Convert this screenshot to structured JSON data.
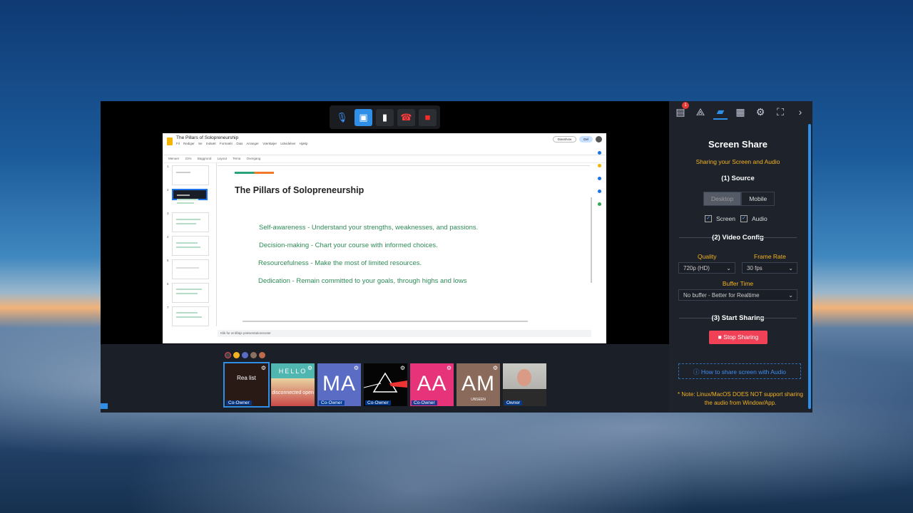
{
  "toolbar": {
    "buttons": [
      "mic-icon",
      "camera-off-icon",
      "signal-icon",
      "hangup-icon",
      "stop-icon"
    ]
  },
  "slides_app": {
    "title": "The Pillars of Solopreneurship",
    "menu": [
      "Fil",
      "Rediger",
      "Se",
      "Indsæt",
      "Formatér",
      "Dias",
      "Arranger",
      "Værktøjer",
      "Udvidelser",
      "Hjælp"
    ],
    "tools": [
      "Menuer",
      "21%",
      "Baggrund",
      "Layout",
      "Tema",
      "Overgang"
    ],
    "slideshow_label": "Diasshow",
    "share_label": "Del",
    "slide_numbers": [
      "1",
      "2",
      "3",
      "4",
      "5",
      "6",
      "7"
    ],
    "notes_placeholder": "Klik for at tilføje præsentationsnoter",
    "slide": {
      "title": "The Pillars of Solopreneurship",
      "bullets": [
        "Self-awareness - Understand your strengths, weaknesses, and passions.",
        "Decision-making - Chart your course with informed choices.",
        "Resourcefulness - Make the most of limited resources.",
        "Dedication - Remain committed to your goals, through highs and lows"
      ]
    }
  },
  "participants": [
    {
      "label": "Rea list",
      "role": "Co-Owner"
    },
    {
      "label": "HELLO",
      "sub": "disconnected open",
      "role": ""
    },
    {
      "label": "MA",
      "role": "Co-Owner"
    },
    {
      "label": "",
      "role": "Co-Owner"
    },
    {
      "label": "AA",
      "role": "Co-Owner"
    },
    {
      "label": "AM",
      "sub": "UNSEEN",
      "role": ""
    },
    {
      "label": "",
      "role": "Owner"
    }
  ],
  "panel": {
    "badge_count": "1",
    "title": "Screen Share",
    "subtitle": "Sharing your Screen and Audio",
    "source_heading": "(1) Source",
    "source_options": [
      "Desktop",
      "Mobile"
    ],
    "screen_label": "Screen",
    "audio_label": "Audio",
    "video_heading": "(2) Video Config",
    "quality_label": "Quality",
    "quality_value": "720p (HD)",
    "framerate_label": "Frame Rate",
    "framerate_value": "30 fps",
    "buffer_label": "Buffer Time",
    "buffer_value": "No buffer - Better for Realtime",
    "start_heading": "(3) Start Sharing",
    "stop_button": "Stop Sharing",
    "howto_link": "How to share screen with Audio",
    "note": "* Note: Linux/MacOS DOES NOT support sharing the audio from Window/App."
  },
  "colors": {
    "accent": "#2f8fe6",
    "danger": "#f04157",
    "warning": "#f5b321",
    "bullet_green": "#2e8b57"
  }
}
